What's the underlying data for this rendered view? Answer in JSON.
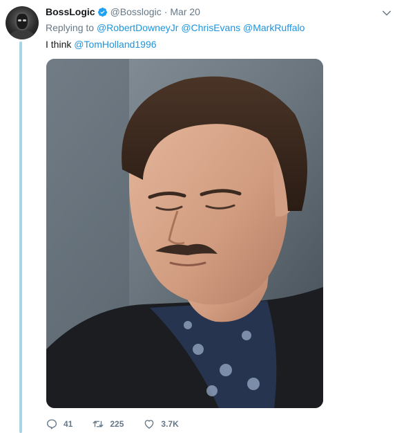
{
  "tweet": {
    "display_name": "BossLogic",
    "handle": "@Bosslogic",
    "separator": "·",
    "date": "Mar 20",
    "replying_label": "Replying to",
    "replying_to": [
      "@RobertDowneyJr",
      "@ChrisEvans",
      "@MarkRuffalo"
    ],
    "text_prefix": "I think",
    "mention": "@TomHolland1996",
    "actions": {
      "replies": "41",
      "retweets": "225",
      "likes": "3.7K"
    }
  },
  "colors": {
    "link": "#1b95e0",
    "muted": "#657786",
    "thread_line": "#a8d5e5"
  },
  "icons": {
    "verified": "verified-badge-icon",
    "caret": "chevron-down-icon",
    "reply": "reply-icon",
    "retweet": "retweet-icon",
    "like": "heart-icon"
  }
}
